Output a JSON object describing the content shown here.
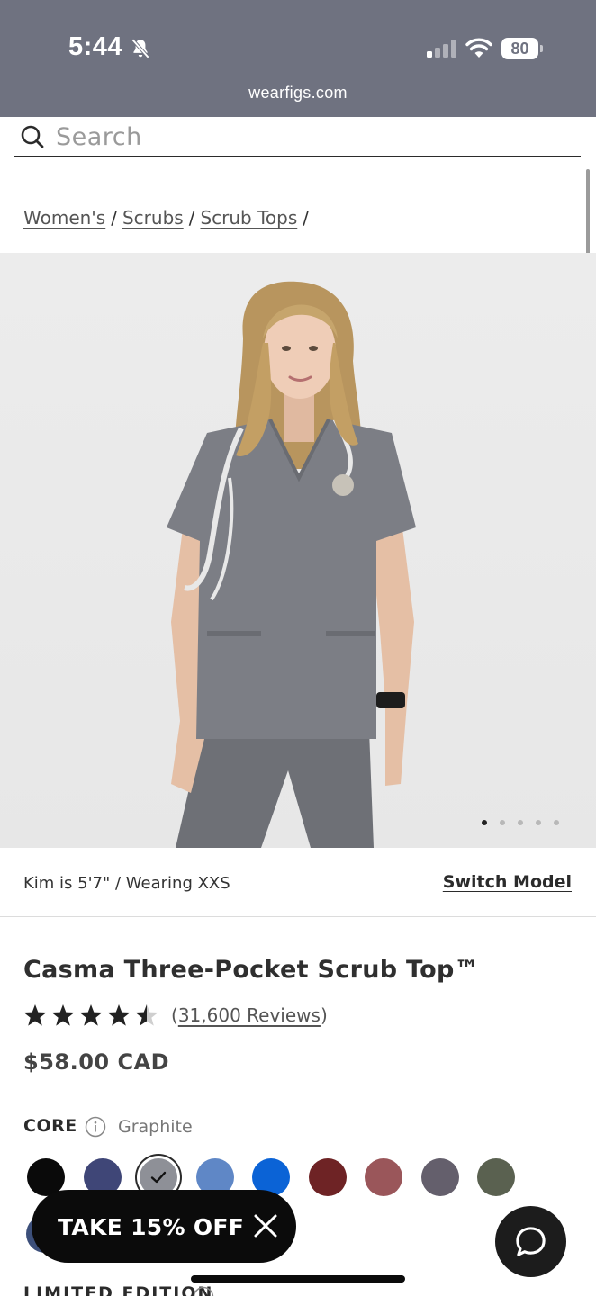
{
  "status_bar": {
    "time": "5:44",
    "battery": "80",
    "url": "wearfigs.com",
    "icons": [
      "bell-slash-icon",
      "signal-icon",
      "wifi-icon",
      "battery-icon"
    ]
  },
  "search": {
    "placeholder": "Search",
    "value": ""
  },
  "breadcrumb": {
    "items": [
      "Women's",
      "Scrubs",
      "Scrub Tops"
    ],
    "separator": "/"
  },
  "gallery": {
    "image_description_icon": "product-photo",
    "slide_count": 5,
    "active_index": 0
  },
  "model": {
    "info": "Kim is 5'7\" / Wearing XXS",
    "switch_label": "Switch Model"
  },
  "product": {
    "title": "Casma Three-Pocket Scrub Top™",
    "rating": 4.5,
    "reviews_open": "(",
    "reviews_text": "31,600 Reviews",
    "reviews_close": ")",
    "price": "$58.00 CAD"
  },
  "colors": {
    "group_label": "CORE",
    "selected_name": "Graphite",
    "swatches": [
      {
        "name": "black",
        "hex": "#0a0a0a",
        "selected": false
      },
      {
        "name": "navy",
        "hex": "#3f4677",
        "selected": false
      },
      {
        "name": "graphite",
        "hex": "#8e9097",
        "selected": true
      },
      {
        "name": "ceil-blue",
        "hex": "#5f87c6",
        "selected": false
      },
      {
        "name": "royal-blue",
        "hex": "#0b63d6",
        "selected": false
      },
      {
        "name": "burgundy",
        "hex": "#6e2325",
        "selected": false
      },
      {
        "name": "mauve",
        "hex": "#9a565a",
        "selected": false
      },
      {
        "name": "charcoal",
        "hex": "#645f6c",
        "selected": false
      },
      {
        "name": "olive",
        "hex": "#5a6150",
        "selected": false
      }
    ],
    "next_group_label": "LIMITED EDITION"
  },
  "promo": {
    "label": "TAKE 15% OFF"
  },
  "colors_theme": {
    "status_bar_bg": "#6f7280",
    "promo_bg": "#0b0b0b"
  }
}
